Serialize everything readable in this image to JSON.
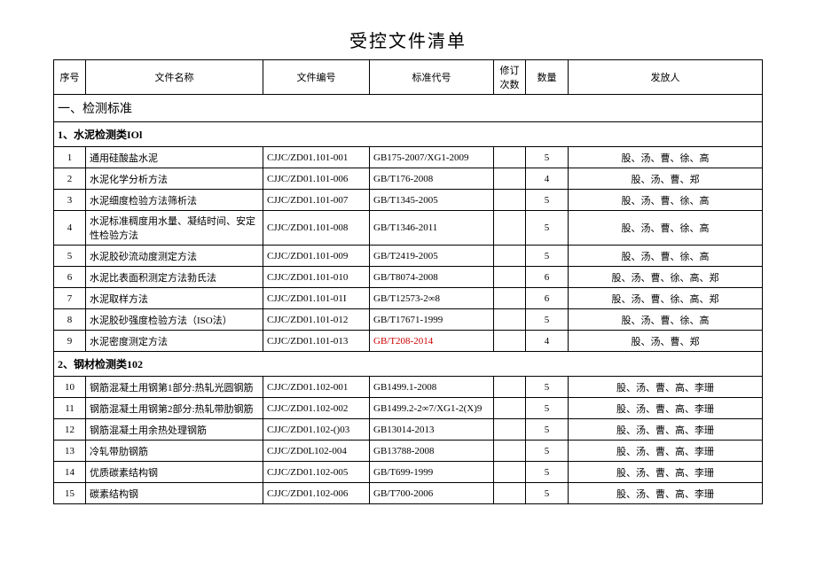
{
  "title": "受控文件清单",
  "headers": {
    "seq": "序号",
    "name": "文件名称",
    "code": "文件编号",
    "std": "标准代号",
    "rev": "修订次数",
    "qty": "数量",
    "dist": "发放人"
  },
  "section1": "一、检测标准",
  "subsection1": "1、水泥检测类IOl",
  "rows1": [
    {
      "seq": "1",
      "name": "通用硅酸盐水泥",
      "code": "CJJC/ZD01.101-001",
      "std": "GB175-2007/XG1-2009",
      "rev": "",
      "qty": "5",
      "dist": "股、汤、曹、徐、高"
    },
    {
      "seq": "2",
      "name": "水泥化学分析方法",
      "code": "CJJC/ZD01.101-006",
      "std": "GB/T176-2008",
      "rev": "",
      "qty": "4",
      "dist": "股、汤、曹、郑"
    },
    {
      "seq": "3",
      "name": "水泥细度检验方法筛析法",
      "code": "CJJC/ZD01.101-007",
      "std": "GB/T1345-2005",
      "rev": "",
      "qty": "5",
      "dist": "股、汤、曹、徐、高"
    },
    {
      "seq": "4",
      "name": "水泥标准稠度用水量、凝结时间、安定性检验方法",
      "code": "CJJC/ZD01.101-008",
      "std": "GB/T1346-2011",
      "rev": "",
      "qty": "5",
      "dist": "股、汤、曹、徐、高"
    },
    {
      "seq": "5",
      "name": "水泥胶砂流动度测定方法",
      "code": "CJJC/ZD01.101-009",
      "std": "GB/T2419-2005",
      "rev": "",
      "qty": "5",
      "dist": "股、汤、曹、徐、高"
    },
    {
      "seq": "6",
      "name": "水泥比表面积测定方法勃氏法",
      "code": "CJJC/ZD01.101-010",
      "std": "GB/T8074-2008",
      "rev": "",
      "qty": "6",
      "dist": "股、汤、曹、徐、高、郑"
    },
    {
      "seq": "7",
      "name": "水泥取样方法",
      "code": "CJJC/ZD01.101-01I",
      "std": "GB/T12573-2∞8",
      "rev": "",
      "qty": "6",
      "dist": "股、汤、曹、徐、高、郑"
    },
    {
      "seq": "8",
      "name": "水泥胶砂强度检验方法（ISO法）",
      "code": "CJJC/ZD01.101-012",
      "std": "GB/T17671-1999",
      "rev": "",
      "qty": "5",
      "dist": "股、汤、曹、徐、高"
    },
    {
      "seq": "9",
      "name": "水泥密度测定方法",
      "code": "CJJC/ZD01.101-013",
      "std": "GB/T208-2014",
      "stdRed": true,
      "rev": "",
      "qty": "4",
      "dist": "股、汤、曹、郑"
    }
  ],
  "subsection2": "2、钢材检测类102",
  "rows2": [
    {
      "seq": "10",
      "name": "钢筋混凝土用钢第1部分:热轧光圆钢筋",
      "code": "CJJC/ZD01.102-001",
      "std": "GB1499.1-2008",
      "rev": "",
      "qty": "5",
      "dist": "股、汤、曹、高、李珊"
    },
    {
      "seq": "11",
      "name": "钢筋混凝土用钢第2部分:热轧带肋钢筋",
      "code": "CJJC/ZD01.102-002",
      "std": "GB1499.2-2∞7/XG1-2(X)9",
      "rev": "",
      "qty": "5",
      "dist": "股、汤、曹、高、李珊"
    },
    {
      "seq": "12",
      "name": "钢筋混凝土用余热处理钢筋",
      "code": "CJJC/ZD01.102-()03",
      "std": "GB13014-2013",
      "rev": "",
      "qty": "5",
      "dist": "股、汤、曹、高、李珊"
    },
    {
      "seq": "13",
      "name": "冷轧带肋钢筋",
      "code": "CJJC/ZD0L102-004",
      "std": "GB13788-2008",
      "rev": "",
      "qty": "5",
      "dist": "股、汤、曹、高、李珊"
    },
    {
      "seq": "14",
      "name": "优质碳素结构钢",
      "code": "CJJC/ZD01.102-005",
      "std": "GB/T699-1999",
      "rev": "",
      "qty": "5",
      "dist": "股、汤、曹、高、李珊"
    },
    {
      "seq": "15",
      "name": "碳素结构钢",
      "code": "CJJC/ZD01.102-006",
      "std": "GB/T700-2006",
      "rev": "",
      "qty": "5",
      "dist": "股、汤、曹、高、李珊"
    }
  ]
}
